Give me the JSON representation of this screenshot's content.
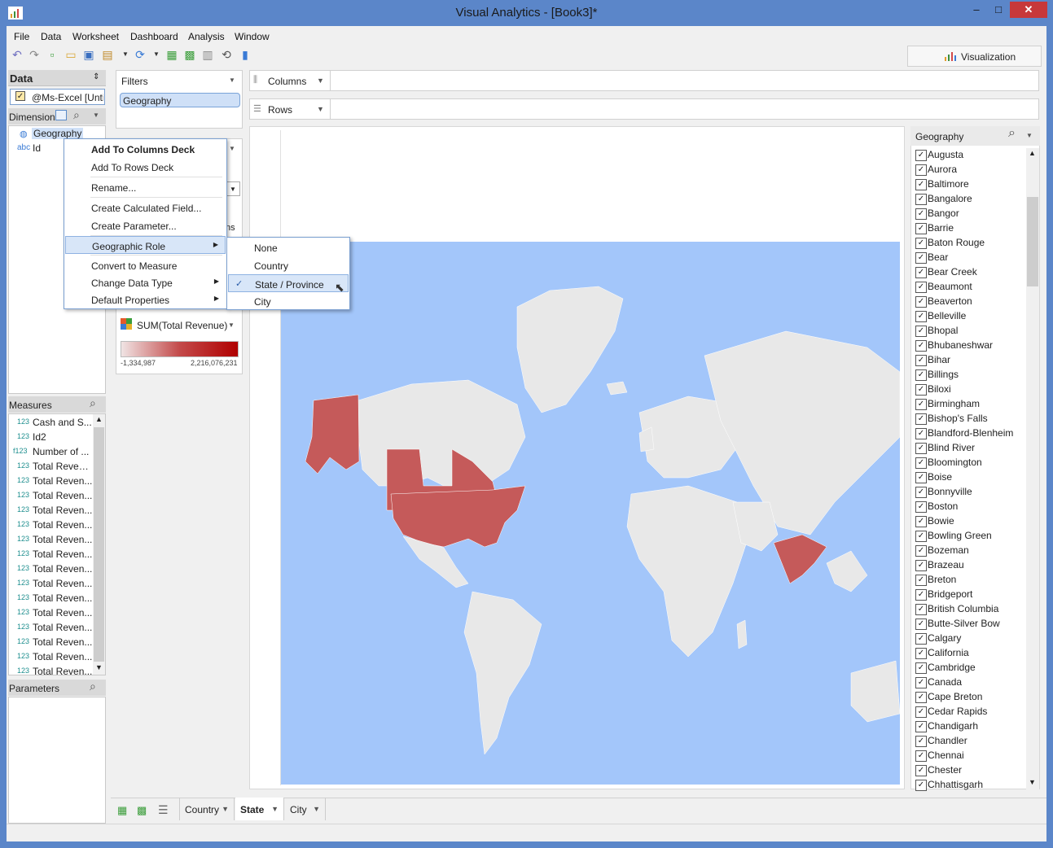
{
  "window": {
    "title": "Visual Analytics - [Book3]*",
    "close": "✕",
    "minimize": "–",
    "maximize": "□"
  },
  "menubar": [
    "File",
    "Data",
    "Worksheet",
    "Dashboard",
    "Analysis",
    "Window"
  ],
  "toolbar": {
    "visualization_label": "Visualization"
  },
  "data_panel": {
    "title": "Data",
    "datasource": "@Ms-Excel [Untitled]",
    "dimensions_label": "Dimensions",
    "dimensions": [
      {
        "type": "geo",
        "name": "Geography",
        "selected": true
      },
      {
        "type": "abc",
        "name": "Id"
      }
    ],
    "measures_label": "Measures",
    "measures": [
      {
        "type": "123",
        "name": "Cash and S..."
      },
      {
        "type": "123",
        "name": "Id2"
      },
      {
        "type": "f123",
        "name": "Number of ..."
      },
      {
        "type": "123",
        "name": "Total Revenue"
      },
      {
        "type": "123",
        "name": "Total Reven..."
      },
      {
        "type": "123",
        "name": "Total Reven..."
      },
      {
        "type": "123",
        "name": "Total Reven..."
      },
      {
        "type": "123",
        "name": "Total Reven..."
      },
      {
        "type": "123",
        "name": "Total Reven..."
      },
      {
        "type": "123",
        "name": "Total Reven..."
      },
      {
        "type": "123",
        "name": "Total Reven..."
      },
      {
        "type": "123",
        "name": "Total Reven..."
      },
      {
        "type": "123",
        "name": "Total Reven..."
      },
      {
        "type": "123",
        "name": "Total Reven..."
      },
      {
        "type": "123",
        "name": "Total Reven..."
      },
      {
        "type": "123",
        "name": "Total Reven..."
      },
      {
        "type": "123",
        "name": "Total Reven..."
      },
      {
        "type": "123",
        "name": "Total Reven..."
      }
    ],
    "parameters_label": "Parameters"
  },
  "filters": {
    "title": "Filters",
    "pill": "Geography"
  },
  "marks": {
    "partial_text": "ns",
    "legend_title": "SUM(Total Revenue)",
    "legend_min": "-1,334,987",
    "legend_max": "2,216,076,231"
  },
  "shelves": {
    "columns": "Columns",
    "rows": "Rows"
  },
  "context_menu": {
    "items": [
      "Add To Columns Deck",
      "Add To Rows Deck",
      "Rename...",
      "Create Calculated Field...",
      "Create Parameter...",
      "Geographic Role",
      "Convert to Measure",
      "Change Data Type",
      "Default Properties"
    ],
    "submenu": [
      "None",
      "Country",
      "State / Province",
      "City"
    ],
    "submenu_checked": "State / Province"
  },
  "geo_filter": {
    "title": "Geography",
    "items": [
      "Augusta",
      "Aurora",
      "Baltimore",
      "Bangalore",
      "Bangor",
      "Barrie",
      "Baton Rouge",
      "Bear",
      "Bear Creek",
      "Beaumont",
      "Beaverton",
      "Belleville",
      "Bhopal",
      "Bhubaneshwar",
      "Bihar",
      "Billings",
      "Biloxi",
      "Birmingham",
      "Bishop's Falls",
      "Blandford-Blenheim",
      "Blind River",
      "Bloomington",
      "Boise",
      "Bonnyville",
      "Boston",
      "Bowie",
      "Bowling Green",
      "Bozeman",
      "Brazeau",
      "Breton",
      "Bridgeport",
      "British Columbia",
      "Butte-Silver Bow",
      "Calgary",
      "California",
      "Cambridge",
      "Canada",
      "Cape Breton",
      "Cedar Rapids",
      "Chandigarh",
      "Chandler",
      "Chennai",
      "Chester",
      "Chhattisgarh"
    ]
  },
  "sheet_tabs": [
    "Country",
    "State",
    "City"
  ],
  "active_tab": "State",
  "colors": {
    "map_water": "#a3c6fa",
    "land": "#e8e8e8",
    "highlight": "#c55a5a",
    "titlebar": "#5b86c9"
  }
}
